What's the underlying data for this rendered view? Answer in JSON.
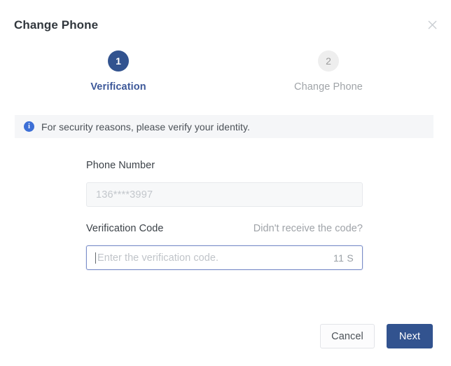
{
  "dialog": {
    "title": "Change Phone",
    "close_icon": "close-icon"
  },
  "stepper": {
    "active_index": 1,
    "steps": [
      {
        "number": "1",
        "label": "Verification",
        "state": "active"
      },
      {
        "number": "2",
        "label": "Change Phone",
        "state": "inactive"
      }
    ],
    "active_color": "#32538f",
    "active_label_color": "#3d5899",
    "inactive_circle_color": "#eeeeee",
    "inactive_label_color": "#a0a4a8",
    "connector_style": "dotted"
  },
  "banner": {
    "icon": "info-circle-icon",
    "icon_glyph": "i",
    "text": "For security reasons, please verify your identity.",
    "background": "#f5f6f8",
    "icon_color": "#3d6fd6"
  },
  "form": {
    "phone": {
      "label": "Phone Number",
      "value": "136****3997",
      "placeholder": "",
      "disabled": true
    },
    "code": {
      "label": "Verification Code",
      "helper_link": "Didn't receive the code?",
      "value": "",
      "placeholder": "Enter the verification code.",
      "countdown": "11 S",
      "focused": true,
      "focus_border_color": "#7b8ec9"
    }
  },
  "footer": {
    "cancel_label": "Cancel",
    "next_label": "Next",
    "primary_color": "#32538f"
  }
}
